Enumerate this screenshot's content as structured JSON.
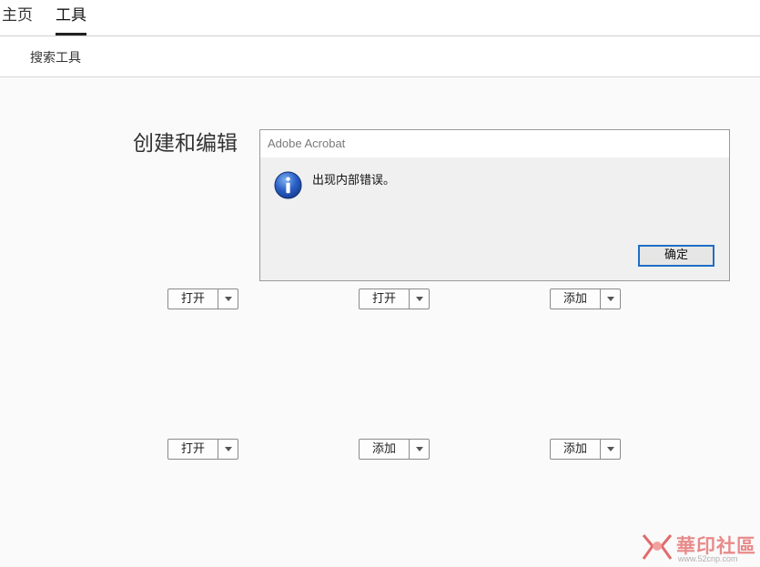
{
  "nav": {
    "tabs": [
      {
        "label": "主页",
        "active": false
      },
      {
        "label": "工具",
        "active": true
      }
    ]
  },
  "subbar": {
    "search_label": "搜索工具"
  },
  "section": {
    "title": "创建和编辑"
  },
  "tool_buttons": [
    {
      "label": "打开"
    },
    {
      "label": "打开"
    },
    {
      "label": "添加"
    },
    {
      "label": "打开"
    },
    {
      "label": "添加"
    },
    {
      "label": "添加"
    }
  ],
  "dialog": {
    "title": "Adobe Acrobat",
    "message": "出现内部错误。",
    "ok_label": "确定",
    "icon": "info-icon"
  },
  "watermark": {
    "text": "華印社區",
    "url": "www.52cnp.com"
  },
  "colors": {
    "accent": "#1e6fc4",
    "background": "#fafafa",
    "watermark": "#e88a8a"
  }
}
